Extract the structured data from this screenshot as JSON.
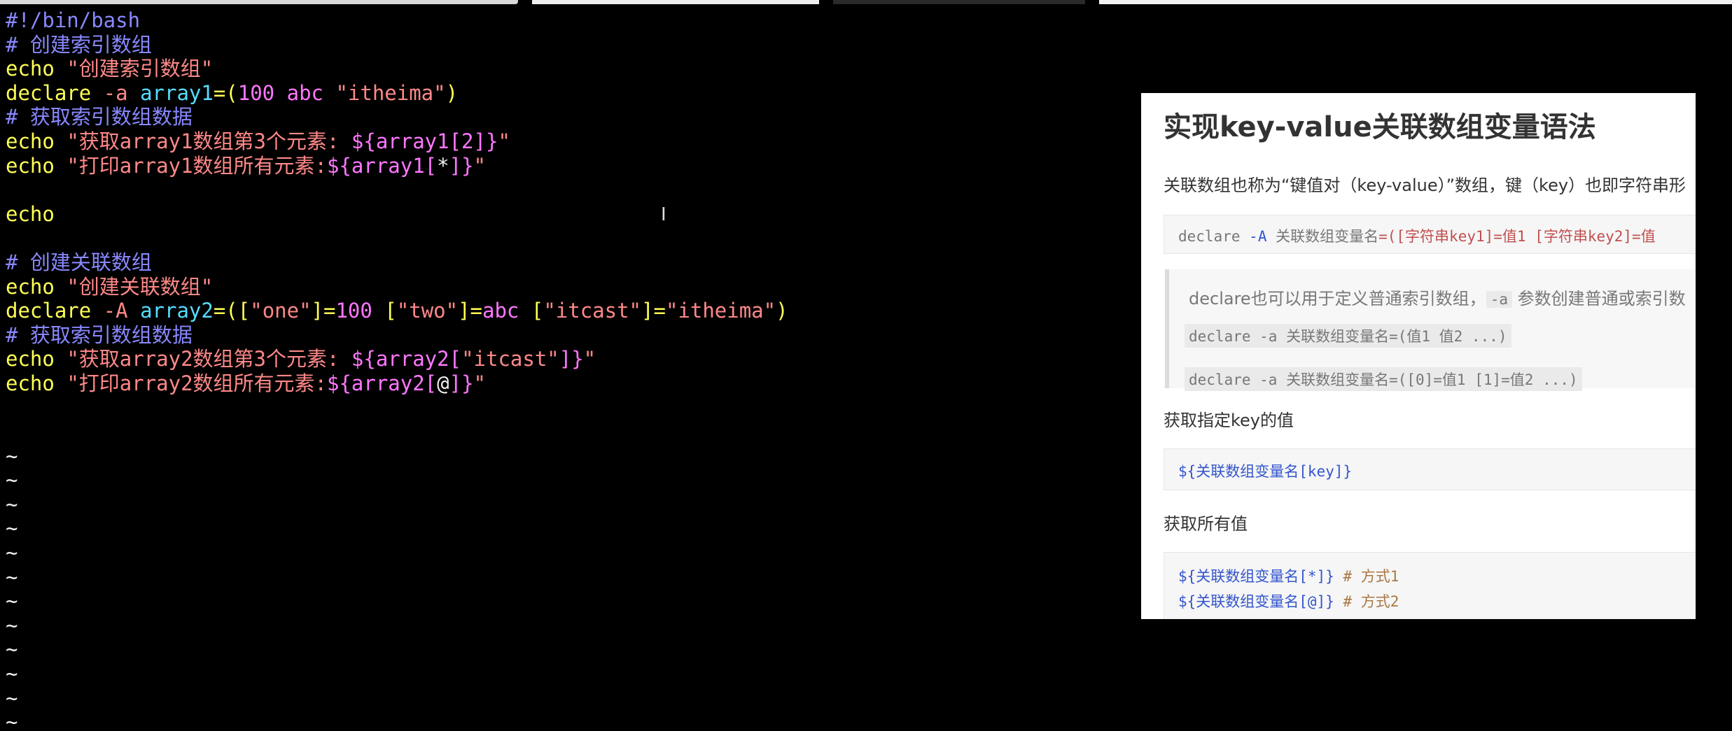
{
  "editor": {
    "lines": [
      [
        {
          "t": "#!/bin/bash",
          "c": "comment"
        }
      ],
      [
        {
          "t": "# 创建索引数组",
          "c": "comment"
        }
      ],
      [
        {
          "t": "echo ",
          "c": "kw"
        },
        {
          "t": "\"创建索引数组\"",
          "c": "str"
        }
      ],
      [
        {
          "t": "declare ",
          "c": "kw"
        },
        {
          "t": "-a ",
          "c": "str"
        },
        {
          "t": "array1",
          "c": "ident"
        },
        {
          "t": "=(",
          "c": "kw"
        },
        {
          "t": "100 abc ",
          "c": "var"
        },
        {
          "t": "\"itheima\"",
          "c": "str"
        },
        {
          "t": ")",
          "c": "kw"
        }
      ],
      [
        {
          "t": "# 获取索引数组数据",
          "c": "comment"
        }
      ],
      [
        {
          "t": "echo ",
          "c": "kw"
        },
        {
          "t": "\"获取array1数组第3个元素: ",
          "c": "str"
        },
        {
          "t": "${array1[2]}",
          "c": "var"
        },
        {
          "t": "\"",
          "c": "str"
        }
      ],
      [
        {
          "t": "echo ",
          "c": "kw"
        },
        {
          "t": "\"打印array1数组所有元素:",
          "c": "str"
        },
        {
          "t": "${array1[",
          "c": "var"
        },
        {
          "t": "*",
          "c": "plain"
        },
        {
          "t": "]}",
          "c": "var"
        },
        {
          "t": "\"",
          "c": "str"
        }
      ],
      [
        {
          "t": "",
          "c": "plain"
        }
      ],
      [
        {
          "t": "echo",
          "c": "kw"
        }
      ],
      [
        {
          "t": "",
          "c": "plain"
        }
      ],
      [
        {
          "t": "# 创建关联数组",
          "c": "comment"
        }
      ],
      [
        {
          "t": "echo ",
          "c": "kw"
        },
        {
          "t": "\"创建关联数组\"",
          "c": "str"
        }
      ],
      [
        {
          "t": "declare ",
          "c": "kw"
        },
        {
          "t": "-A ",
          "c": "str"
        },
        {
          "t": "array2",
          "c": "ident"
        },
        {
          "t": "=([",
          "c": "kw"
        },
        {
          "t": "\"one\"",
          "c": "str"
        },
        {
          "t": "]=",
          "c": "kw"
        },
        {
          "t": "100 ",
          "c": "var"
        },
        {
          "t": "[",
          "c": "kw"
        },
        {
          "t": "\"two\"",
          "c": "str"
        },
        {
          "t": "]=",
          "c": "kw"
        },
        {
          "t": "abc ",
          "c": "var"
        },
        {
          "t": "[",
          "c": "kw"
        },
        {
          "t": "\"itcast\"",
          "c": "str"
        },
        {
          "t": "]=",
          "c": "kw"
        },
        {
          "t": "\"itheima\"",
          "c": "str"
        },
        {
          "t": ")",
          "c": "kw"
        }
      ],
      [
        {
          "t": "# 获取索引数组数据",
          "c": "comment"
        }
      ],
      [
        {
          "t": "echo ",
          "c": "kw"
        },
        {
          "t": "\"获取array2数组第3个元素: ",
          "c": "str"
        },
        {
          "t": "${array2[",
          "c": "var"
        },
        {
          "t": "\"itcast\"",
          "c": "str"
        },
        {
          "t": "]}",
          "c": "var"
        },
        {
          "t": "\"",
          "c": "str"
        }
      ],
      [
        {
          "t": "echo ",
          "c": "kw"
        },
        {
          "t": "\"打印array2数组所有元素:",
          "c": "str"
        },
        {
          "t": "${array2[",
          "c": "var"
        },
        {
          "t": "@",
          "c": "plain"
        },
        {
          "t": "]}",
          "c": "var"
        },
        {
          "t": "\"",
          "c": "str"
        }
      ],
      [
        {
          "t": "",
          "c": "plain"
        }
      ],
      [
        {
          "t": "",
          "c": "plain"
        }
      ],
      [
        {
          "t": "~",
          "c": "tilde"
        }
      ],
      [
        {
          "t": "~",
          "c": "tilde"
        }
      ],
      [
        {
          "t": "~",
          "c": "tilde"
        }
      ],
      [
        {
          "t": "~",
          "c": "tilde"
        }
      ],
      [
        {
          "t": "~",
          "c": "tilde"
        }
      ],
      [
        {
          "t": "~",
          "c": "tilde"
        }
      ],
      [
        {
          "t": "~",
          "c": "tilde"
        }
      ],
      [
        {
          "t": "~",
          "c": "tilde"
        }
      ],
      [
        {
          "t": "~",
          "c": "tilde"
        }
      ],
      [
        {
          "t": "~",
          "c": "tilde"
        }
      ],
      [
        {
          "t": "~",
          "c": "tilde"
        }
      ],
      [
        {
          "t": "~",
          "c": "tilde"
        }
      ]
    ],
    "cursor_glyph": "I"
  },
  "doc": {
    "title": "实现key-value关联数组变量语法",
    "intro": "关联数组也称为“键值对（key-value）”数组，键（key）也即字符串形",
    "syntax": {
      "kw": "declare",
      "flag": "-A",
      "name": "关联数组变量名",
      "rest": "=([字符串key1]=值1 [字符串key2]=值"
    },
    "note": {
      "text_before": "declare也可以用于定义普通索引数组，",
      "flag": "-a",
      "text_after": " 参数创建普通或索引数",
      "code1": "declare -a 关联数组变量名=(值1 值2 ...)",
      "code2": "declare -a 关联数组变量名=([0]=值1 [1]=值2 ...)"
    },
    "get_value_heading": "获取指定key的值",
    "get_value_code": "${关联数组变量名[key]}",
    "get_all_heading": "获取所有值",
    "get_all_code1": "${关联数组变量名[*]}",
    "get_all_comment1": "# 方式1",
    "get_all_code2": "${关联数组变量名[@]}",
    "get_all_comment2": "# 方式2"
  }
}
